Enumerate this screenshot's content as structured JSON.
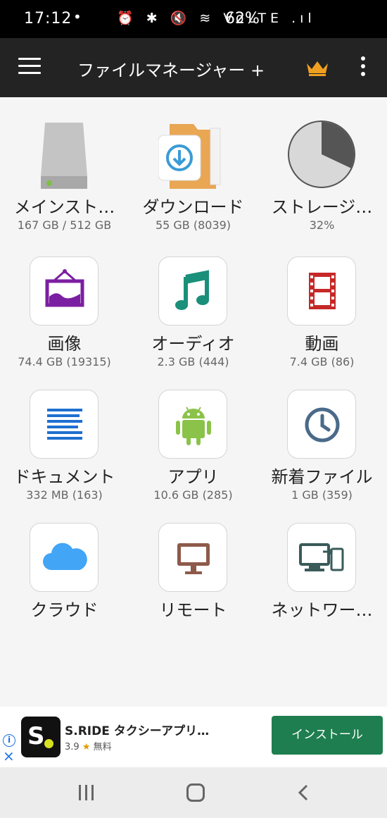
{
  "status": {
    "time": "17:12",
    "dot": "•",
    "icons": "⏰ ✱ 🔇 ≋ VoLTE .ıl",
    "battery": "62%"
  },
  "app": {
    "title": "ファイルマネージャー +"
  },
  "tiles": [
    {
      "label": "メインスト…",
      "sub": "167 GB / 512 GB"
    },
    {
      "label": "ダウンロード",
      "sub": "55 GB (8039)"
    },
    {
      "label": "ストレージ…",
      "sub": "32%"
    },
    {
      "label": "画像",
      "sub": "74.4 GB (19315)"
    },
    {
      "label": "オーディオ",
      "sub": "2.3 GB (444)"
    },
    {
      "label": "動画",
      "sub": "7.4 GB (86)"
    },
    {
      "label": "ドキュメント",
      "sub": "332 MB (163)"
    },
    {
      "label": "アプリ",
      "sub": "10.6 GB (285)"
    },
    {
      "label": "新着ファイル",
      "sub": "1 GB (359)"
    },
    {
      "label": "クラウド",
      "sub": ""
    },
    {
      "label": "リモート",
      "sub": ""
    },
    {
      "label": "ネットワー…",
      "sub": ""
    }
  ],
  "storage_usage_percent": 32,
  "ad": {
    "logo_letter": "S",
    "app_name": "S.RIDE タクシーアプリ…",
    "rating": "3.9",
    "star": "★",
    "price": "無料",
    "install": "インストール",
    "info": "i",
    "close": "×"
  },
  "colors": {
    "appbar": "#232323",
    "crown": "#f0a020",
    "install": "#1e7e4f",
    "image": "#7b1fa2",
    "audio": "#1a8f7a",
    "video": "#c62828",
    "doc": "#1e6fd0",
    "android": "#8bc34a",
    "clock": "#4a6a8a",
    "cloud": "#42a5f5",
    "remote": "#8d5a4a",
    "network": "#3a5a5a"
  }
}
